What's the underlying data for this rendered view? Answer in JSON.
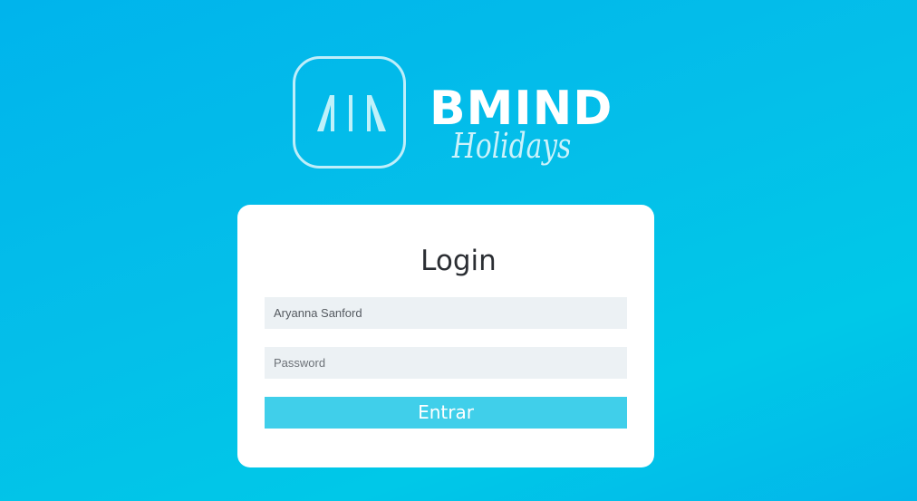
{
  "brand": {
    "name": "BMIND",
    "sub": "Holidays",
    "logo_icon": "bmind-logo-icon",
    "logo_color": "#ffffff"
  },
  "login": {
    "title": "Login",
    "username_value": "Aryanna Sanford",
    "password_placeholder": "Password",
    "submit_label": "Entrar"
  },
  "colors": {
    "background": "#00bfea",
    "card": "#ffffff",
    "input_bg": "#ecf1f4",
    "button": "#40cfea"
  }
}
